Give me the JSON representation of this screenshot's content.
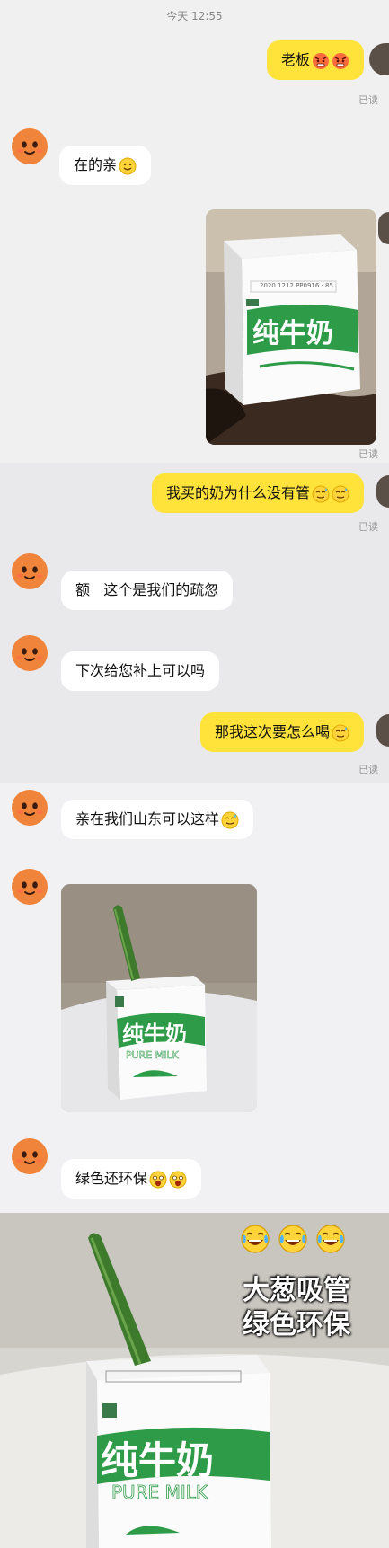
{
  "chat": {
    "timestamp": "今天 12:55",
    "read_label": "已读",
    "messages": [
      {
        "from": "me",
        "text": "老板"
      },
      {
        "from": "them",
        "text": "在的亲"
      },
      {
        "from": "me",
        "type": "image"
      },
      {
        "from": "me",
        "text": "我买的奶为什么没有管"
      },
      {
        "from": "them",
        "text": "额   这个是我们的疏忽"
      },
      {
        "from": "them",
        "text": "下次给您补上可以吗"
      },
      {
        "from": "me",
        "text": "那我这次要怎么喝"
      },
      {
        "from": "them",
        "text": "亲在我们山东可以这样"
      },
      {
        "from": "them",
        "type": "image"
      },
      {
        "from": "them",
        "text": "绿色还环保"
      }
    ]
  },
  "product": {
    "name": "纯牛奶",
    "english": "PURE MILK",
    "print_code": "2020 1212 PP0916 · 85"
  },
  "meme": {
    "caption_line1": "大葱吸管",
    "caption_line2": "绿色环保",
    "emoji": "laughing-crying-icon"
  },
  "colors": {
    "my_bubble": "#ffe23a",
    "their_bubble": "#ffffff",
    "milk_green": "#2e9b48"
  }
}
